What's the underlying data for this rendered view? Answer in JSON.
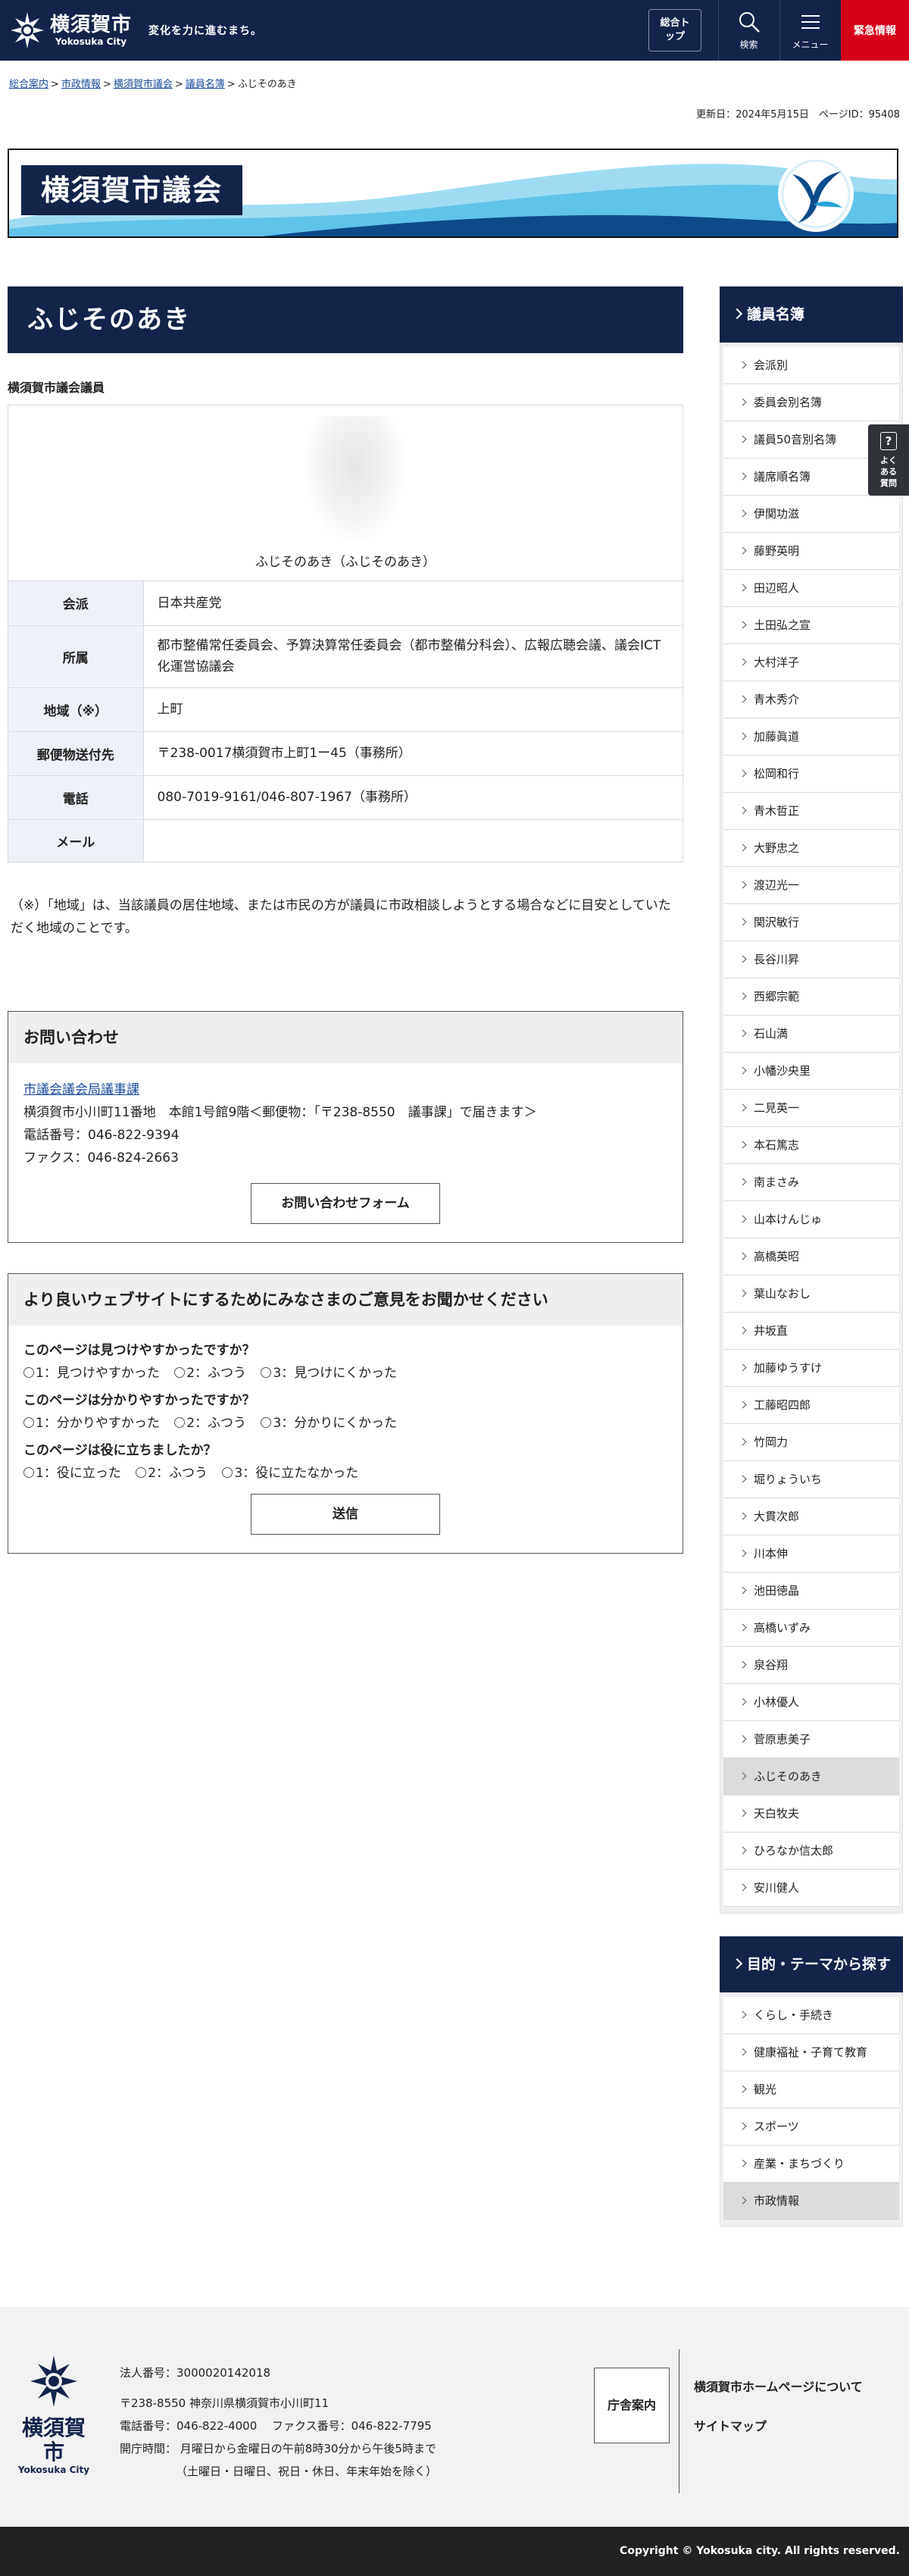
{
  "header": {
    "logo_jp": "横須賀市",
    "logo_en": "Yokosuka City",
    "tagline": "変化を力に進むまち。",
    "top_button": "総合トップ",
    "search": "検索",
    "menu": "メニュー",
    "emergency": "緊急情報",
    "brand_color": "#13234a",
    "emergency_color": "#d7001b"
  },
  "breadcrumb": {
    "items": [
      "総合案内",
      "市政情報",
      "横須賀市議会",
      "議員名簿"
    ],
    "current": "ふじそのあき",
    "sep": ">"
  },
  "meta": {
    "updated": "更新日：2024年5月15日　ページID：95408"
  },
  "banner": {
    "title": "横須賀市議会"
  },
  "main": {
    "title": "ふじそのあき",
    "org_label": "横須賀市議会議員",
    "photo_caption": "ふじそのあき（ふじそのあき）",
    "rows": [
      {
        "label": "会派",
        "value": "日本共産党"
      },
      {
        "label": "所属",
        "value": "都市整備常任委員会、予算決算常任委員会（都市整備分科会）、広報広聴会議、議会ICT化運営協議会"
      },
      {
        "label": "地域（※）",
        "value": "上町"
      },
      {
        "label": "郵便物送付先",
        "value": "〒238-0017横須賀市上町1ー45（事務所）"
      },
      {
        "label": "電話",
        "value": "080-7019-9161/046-807-1967（事務所）"
      },
      {
        "label": "メール",
        "value": ""
      }
    ],
    "note": "（※）「地域」は、当該議員の居住地域、または市民の方が議員に市政相談しようとする場合などに目安としていただく地域のことです。"
  },
  "contact": {
    "heading": "お問い合わせ",
    "dept": "市議会議会局議事課",
    "address": "横須賀市小川町11番地　本館1号館9階＜郵便物：「〒238-8550　議事課」で届きます＞",
    "phone": "電話番号：046-822-9394",
    "fax": "ファクス：046-824-2663",
    "button": "お問い合わせフォーム"
  },
  "survey": {
    "heading": "より良いウェブサイトにするためにみなさまのご意見をお聞かせください",
    "q1": "このページは見つけやすかったですか？",
    "q1_opts": [
      "1：見つけやすかった",
      "2：ふつう",
      "3：見つけにくかった"
    ],
    "q2": "このページは分かりやすかったですか？",
    "q2_opts": [
      "1：分かりやすかった",
      "2：ふつう",
      "3：分かりにくかった"
    ],
    "q3": "このページは役に立ちましたか？",
    "q3_opts": [
      "1：役に立った",
      "2：ふつう",
      "3：役に立たなかった"
    ],
    "submit": "送信"
  },
  "sidebar": {
    "heading": "議員名簿",
    "items": [
      "会派別",
      "委員会別名簿",
      "議員50音別名簿",
      "議席順名簿",
      "伊関功滋",
      "藤野英明",
      "田辺昭人",
      "土田弘之宣",
      "大村洋子",
      "青木秀介",
      "加藤眞道",
      "松岡和行",
      "青木哲正",
      "大野忠之",
      "渡辺光一",
      "関沢敏行",
      "長谷川昇",
      "西郷宗範",
      "石山満",
      "小幡沙央里",
      "二見英一",
      "本石篤志",
      "南まさみ",
      "山本けんじゅ",
      "高橋英昭",
      "葉山なおし",
      "井坂直",
      "加藤ゆうすけ",
      "工藤昭四郎",
      "竹岡力",
      "堀りょういち",
      "大貫次郎",
      "川本伸",
      "池田徳晶",
      "高橋いずみ",
      "泉谷翔",
      "小林優人",
      "菅原恵美子",
      "ふじそのあき",
      "天白牧夫",
      "ひろなか信太郎",
      "安川健人"
    ],
    "current": "ふじそのあき",
    "theme_heading": "目的・テーマから探す",
    "theme_items": [
      "くらし・手続き",
      "健康福祉・子育て教育",
      "観光",
      "スポーツ",
      "産業・まちづくり",
      "市政情報"
    ],
    "theme_current": "市政情報"
  },
  "faq_tab": {
    "label": "よくある質問",
    "icon": "?"
  },
  "footer": {
    "logo_jp": "横須賀市",
    "logo_en": "Yokosuka City",
    "corp_no": "法人番号：3000020142018",
    "address": "〒238-8550 神奈川県横須賀市小川町11",
    "phone": "電話番号：046-822-4000　 ファクス番号：046-822-7795",
    "hours": "開庁時間：  月曜日から金曜日の午前8時30分から午後5時まで",
    "hours2": "（土曜日・日曜日、祝日・休日、年末年始を除く）",
    "guide": "庁舎案内",
    "link1": "横須賀市ホームページについて",
    "link2": "サイトマップ",
    "copyright": "Copyright © Yokosuka city. All rights reserved."
  }
}
